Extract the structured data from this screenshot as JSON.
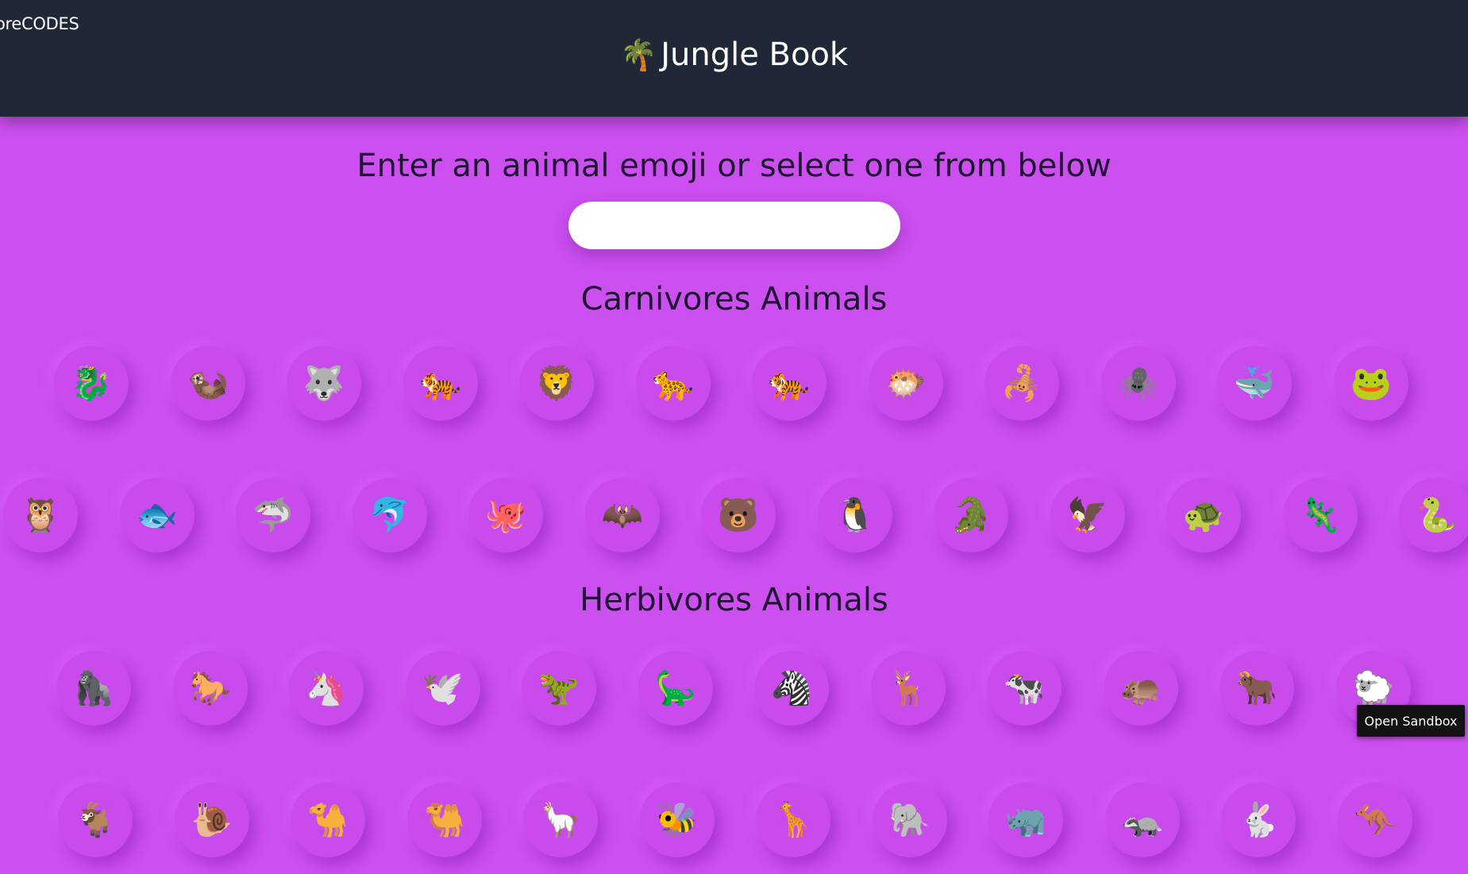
{
  "header": {
    "corner_text": "oreCODES",
    "palm_icon": "🌴",
    "title": "Jungle Book",
    "background": "#202838"
  },
  "colors": {
    "page_background": "#cc4ff0",
    "tile_background": "#c94bec"
  },
  "prompt": "Enter an animal emoji or select one from below",
  "search": {
    "value": "",
    "placeholder": ""
  },
  "carnivores": {
    "title": "Carnivores Animals",
    "rows": [
      [
        "🐉",
        "🦦",
        "🐺",
        "🐅",
        "🦁",
        "🐆",
        "🐅",
        "🐡",
        "🦂",
        "🕷️",
        "🐳",
        "🐸"
      ],
      [
        "🦉",
        "🐟",
        "🦈",
        "🐬",
        "🐙",
        "🦇",
        "🐻",
        "🐧",
        "🐊",
        "🦅",
        "🐢",
        "🦎",
        "🐍"
      ]
    ]
  },
  "herbivores": {
    "title": "Herbivores Animals",
    "rows": [
      [
        "🦍",
        "🐎",
        "🦄",
        "🕊️",
        "🦖",
        "🦕",
        "🦓",
        "🦌",
        "🐄",
        "🦛",
        "🐂",
        "🐑"
      ],
      [
        "🐐",
        "🐌",
        "🐪",
        "🐫",
        "🦙",
        "🐝",
        "🦒",
        "🐘",
        "🦏",
        "🦡",
        "🐇",
        "🦘"
      ]
    ]
  },
  "tooltip": "Open Sandbox"
}
